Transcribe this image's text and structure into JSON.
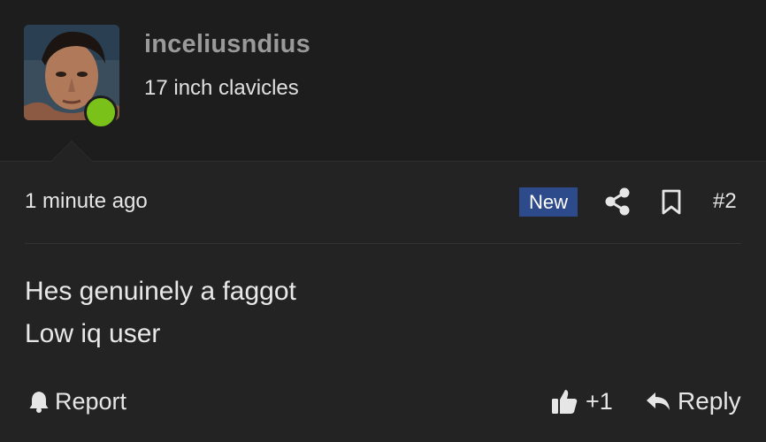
{
  "author": {
    "username": "inceliusndius",
    "title": "17 inch clavicles",
    "online_color": "#7ac21a",
    "avatar": "profile-photo"
  },
  "post": {
    "timestamp": "1 minute ago",
    "badge": "New",
    "badge_color": "#2d4a8a",
    "number": "#2",
    "lines": [
      "Hes genuinely a faggot",
      "Low iq user"
    ]
  },
  "actions": {
    "report_label": "Report",
    "like_count": "+1",
    "reply_label": "Reply",
    "icons": [
      "bell-icon",
      "thumbs-up-icon",
      "reply-arrow-icon",
      "share-icon",
      "bookmark-icon"
    ]
  }
}
